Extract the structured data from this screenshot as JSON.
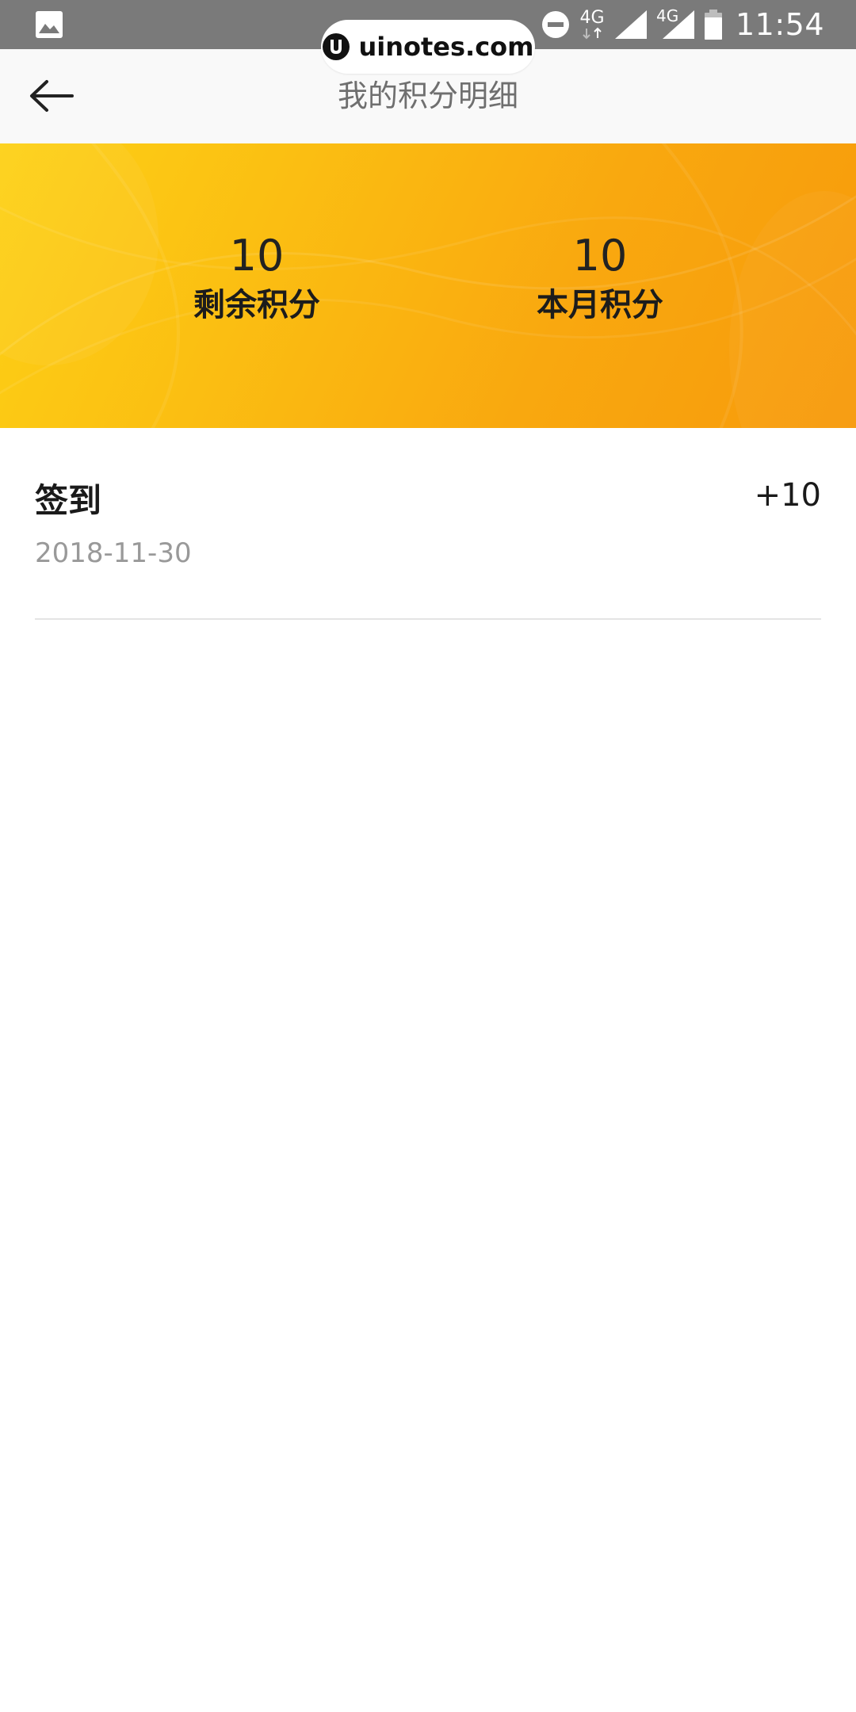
{
  "status_bar": {
    "time": "11:54",
    "network_1": "4G",
    "network_2": "4G",
    "icons": [
      "image-icon",
      "do-not-disturb-icon",
      "signal-icon",
      "signal-icon",
      "battery-icon"
    ]
  },
  "watermark": {
    "text": "uinotes.com"
  },
  "header": {
    "title": "我的积分明细",
    "back_icon": "back-arrow-icon"
  },
  "summary": {
    "remaining": {
      "value": "10",
      "label": "剩余积分"
    },
    "this_month": {
      "value": "10",
      "label": "本月积分"
    },
    "colors": {
      "gradient_start": "#fdd116",
      "gradient_end": "#f79a0b"
    }
  },
  "records": [
    {
      "title": "签到",
      "date": "2018-11-30",
      "points": "+10"
    }
  ]
}
